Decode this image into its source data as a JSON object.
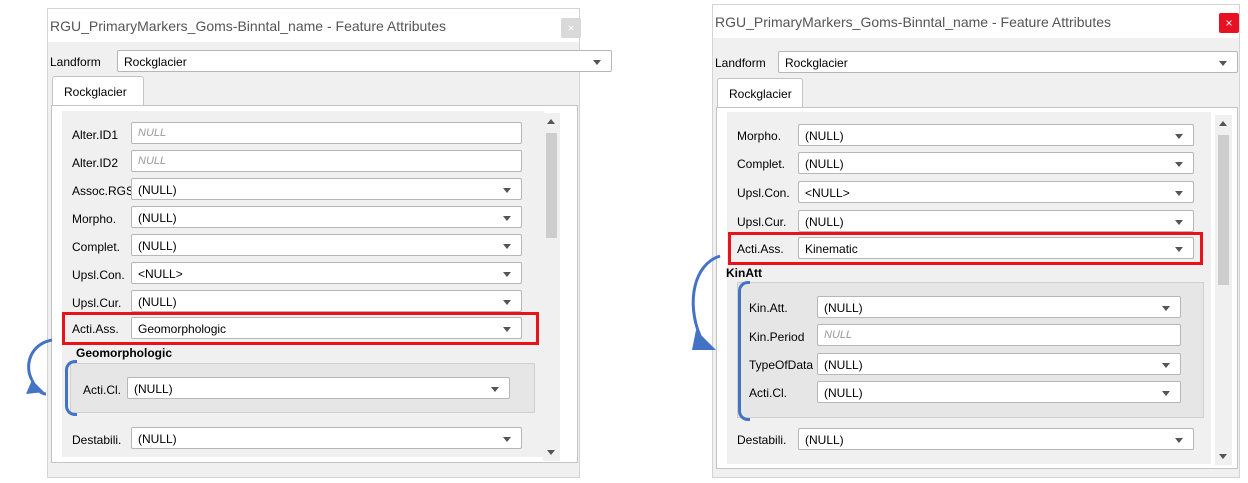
{
  "left_dialog": {
    "title": "RGU_PrimaryMarkers_Goms-Binntal_name - Feature Attributes",
    "close_label": "×",
    "landform_label": "Landform",
    "landform_value": "Rockglacier",
    "tab_label": "Rockglacier",
    "fields": {
      "alter_id1": {
        "label": "Alter.ID1",
        "placeholder": "NULL"
      },
      "alter_id2": {
        "label": "Alter.ID2",
        "placeholder": "NULL"
      },
      "assoc_rgs": {
        "label": "Assoc.RGS",
        "value": "(NULL)"
      },
      "morpho": {
        "label": "Morpho.",
        "value": "(NULL)"
      },
      "complet": {
        "label": "Complet.",
        "value": "(NULL)"
      },
      "upsl_con": {
        "label": "Upsl.Con.",
        "value": "<NULL>"
      },
      "upsl_cur": {
        "label": "Upsl.Cur.",
        "value": "(NULL)"
      },
      "acti_ass": {
        "label": "Acti.Ass.",
        "value": "Geomorphologic"
      },
      "destabili": {
        "label": "Destabili.",
        "value": "(NULL)"
      }
    },
    "group": {
      "title": "Geomorphologic",
      "acti_cl": {
        "label": "Acti.Cl.",
        "value": "(NULL)"
      }
    }
  },
  "right_dialog": {
    "title": "RGU_PrimaryMarkers_Goms-Binntal_name - Feature Attributes",
    "close_label": "×",
    "landform_label": "Landform",
    "landform_value": "Rockglacier",
    "tab_label": "Rockglacier",
    "fields": {
      "morpho": {
        "label": "Morpho.",
        "value": "(NULL)"
      },
      "complet": {
        "label": "Complet.",
        "value": "(NULL)"
      },
      "upsl_con": {
        "label": "Upsl.Con.",
        "value": "<NULL>"
      },
      "upsl_cur": {
        "label": "Upsl.Cur.",
        "value": "(NULL)"
      },
      "acti_ass": {
        "label": "Acti.Ass.",
        "value": "Kinematic"
      },
      "destabili": {
        "label": "Destabili.",
        "value": "(NULL)"
      }
    },
    "group": {
      "title": "KinAtt",
      "kin_att": {
        "label": "Kin.Att.",
        "value": "(NULL)"
      },
      "kin_period": {
        "label": "Kin.Period",
        "placeholder": "NULL"
      },
      "type_of_data": {
        "label": "TypeOfData",
        "value": "(NULL)"
      },
      "acti_cl": {
        "label": "Acti.Cl.",
        "value": "(NULL)"
      }
    }
  },
  "colors": {
    "highlight": "#e8121b",
    "annotation": "#4472c4",
    "close_active": "#e81123",
    "close_inactive": "#d9d9d9"
  }
}
